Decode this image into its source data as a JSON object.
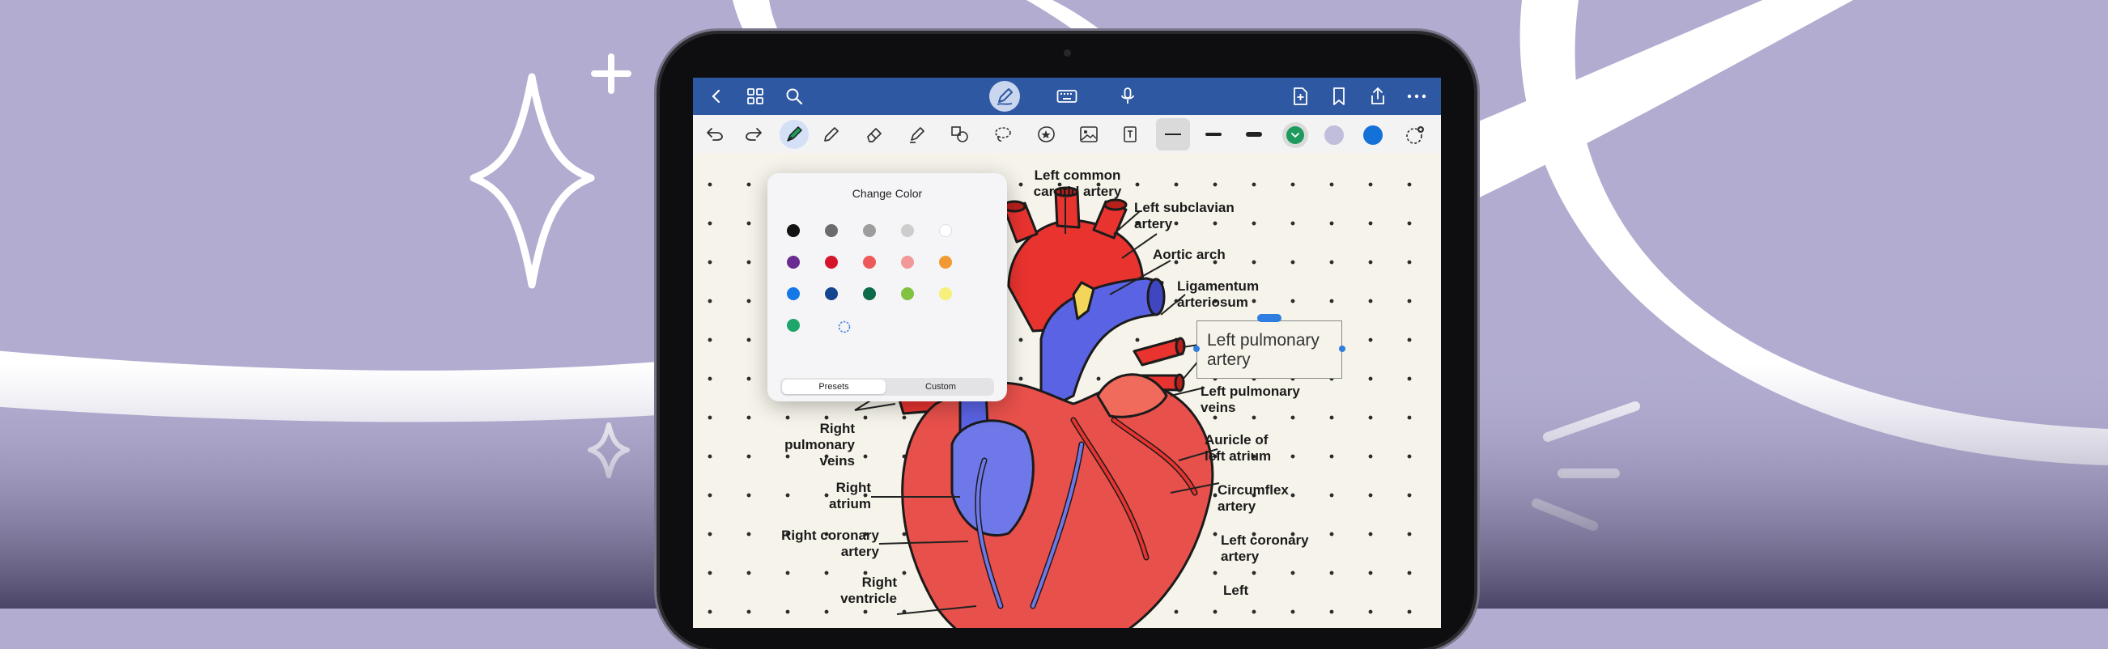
{
  "topbar": {
    "left_icons": [
      "back-icon",
      "grid-icon",
      "search-icon"
    ],
    "center_icons": [
      "pen-mode-icon",
      "keyboard-icon",
      "microphone-icon"
    ],
    "right_icons": [
      "add-page-icon",
      "bookmark-icon",
      "share-icon",
      "more-icon"
    ]
  },
  "toolbar": {
    "tools": [
      "undo-icon",
      "redo-icon",
      "fountain-pen-icon",
      "pencil-icon",
      "eraser-icon",
      "highlighter-icon",
      "shapes-icon",
      "lasso-icon",
      "sticker-icon",
      "image-icon",
      "text-icon"
    ],
    "stroke_widths": [
      "thin",
      "medium",
      "thick"
    ],
    "pen_colors": [
      "#1e9a5c",
      "#c0bedc",
      "#1471d8"
    ],
    "accent": "#2f58a2"
  },
  "popup": {
    "title": "Change Color",
    "colors": [
      [
        "#121212",
        "#6b6b6b",
        "#9d9d9d",
        "#cdcdcd",
        "#ffffff"
      ],
      [
        "#6b2c91",
        "#d5142a",
        "#ee5a5a",
        "#f19999",
        "#f19a33"
      ],
      [
        "#1677e8",
        "#14458e",
        "#0c6b48",
        "#82c241",
        "#f6ef7a"
      ],
      [
        "#1ea56a"
      ]
    ],
    "tab_presets": "Presets",
    "tab_custom": "Custom"
  },
  "labels": {
    "left_common_carotid": "Left common\ncarotid artery",
    "left_subclavian": "Left subclavian\nartery",
    "aortic_arch": "Aortic arch",
    "ligamentum": "Ligamentum\narteriosum",
    "left_pulmonary_veins": "Left pulmonary\nveins",
    "auricle": "Auricle of\nleft atrium",
    "circumflex": "Circumflex\nartery",
    "left_coronary": "Left coronary\nartery",
    "left_ventricle": "Left",
    "right_pulmonary_veins": "Right\npulmonary\nveins",
    "right_atrium": "Right\natrium",
    "right_coronary": "Right coronary\nartery",
    "right_ventricle": "Right\nventricle"
  },
  "textbox": {
    "text": "Left pulmonary\nartery"
  }
}
